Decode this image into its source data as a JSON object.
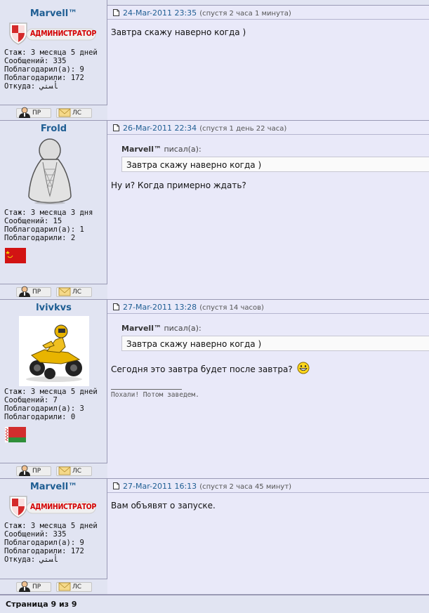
{
  "posts": [
    {
      "author": "Marvell™",
      "rank": "АДМИНИСТРАТОР",
      "date": "24-Mar-2011 23:35",
      "ago": "(спустя 2 часа 1 минута)",
      "stats": [
        "Стаж: 3 месяца 5 дней",
        "Сообщений: 335",
        "Поблагодарил(а): 9",
        "Поблагодарили: 172",
        "Откуда: ﺄﺴﺘﻲ"
      ],
      "message": "Завтра скажу наверно когда )"
    },
    {
      "author": "Frold",
      "date": "26-Mar-2011 22:34",
      "ago": "(спустя 1 день 22 часа)",
      "stats": [
        "Стаж: 3 месяца 3 дня",
        "Сообщений: 15",
        "Поблагодарил(а): 1",
        "Поблагодарили: 2"
      ],
      "quote_author": "Marvell™",
      "quote_suffix": "писал(а):",
      "quote_text": "Завтра скажу наверно когда )",
      "message": "Ну и? Когда примерно ждать?"
    },
    {
      "author": "lvivkvs",
      "date": "27-Mar-2011 13:28",
      "ago": "(спустя 14 часов)",
      "stats": [
        "Стаж: 3 месяца 5 дней",
        "Сообщений: 7",
        "Поблагодарил(а): 3",
        "Поблагодарили: 0"
      ],
      "quote_author": "Marvell™",
      "quote_suffix": "писал(а):",
      "quote_text": "Завтра скажу наверно когда )",
      "message": "Сегодня это завтра будет после завтра?",
      "signature": "Похали! Потом заведем."
    },
    {
      "author": "Marvell™",
      "rank": "АДМИНИСТРАТОР",
      "date": "27-Mar-2011 16:13",
      "ago": "(спустя 2 часа 45 минут)",
      "stats": [
        "Стаж: 3 месяца 5 дней",
        "Сообщений: 335",
        "Поблагодарил(а): 9",
        "Поблагодарили: 172",
        "Откуда: ﺄﺴﺘﻲ"
      ],
      "message": "Вам объявят о запуске."
    }
  ],
  "buttons": {
    "pm": "ПР",
    "ls": "ЛС"
  },
  "footer": {
    "pagination": "Страница 9 из 9"
  },
  "colors": {
    "link": "#1f5e93",
    "admin_red": "#d40000",
    "panel": "#e1e4f2",
    "post_bg": "#e9e9f9"
  },
  "icons": [
    "document-icon",
    "user-icon",
    "envelope-icon",
    "shield-icon",
    "avatar-icon",
    "flag-icon",
    "smiley-icon"
  ]
}
